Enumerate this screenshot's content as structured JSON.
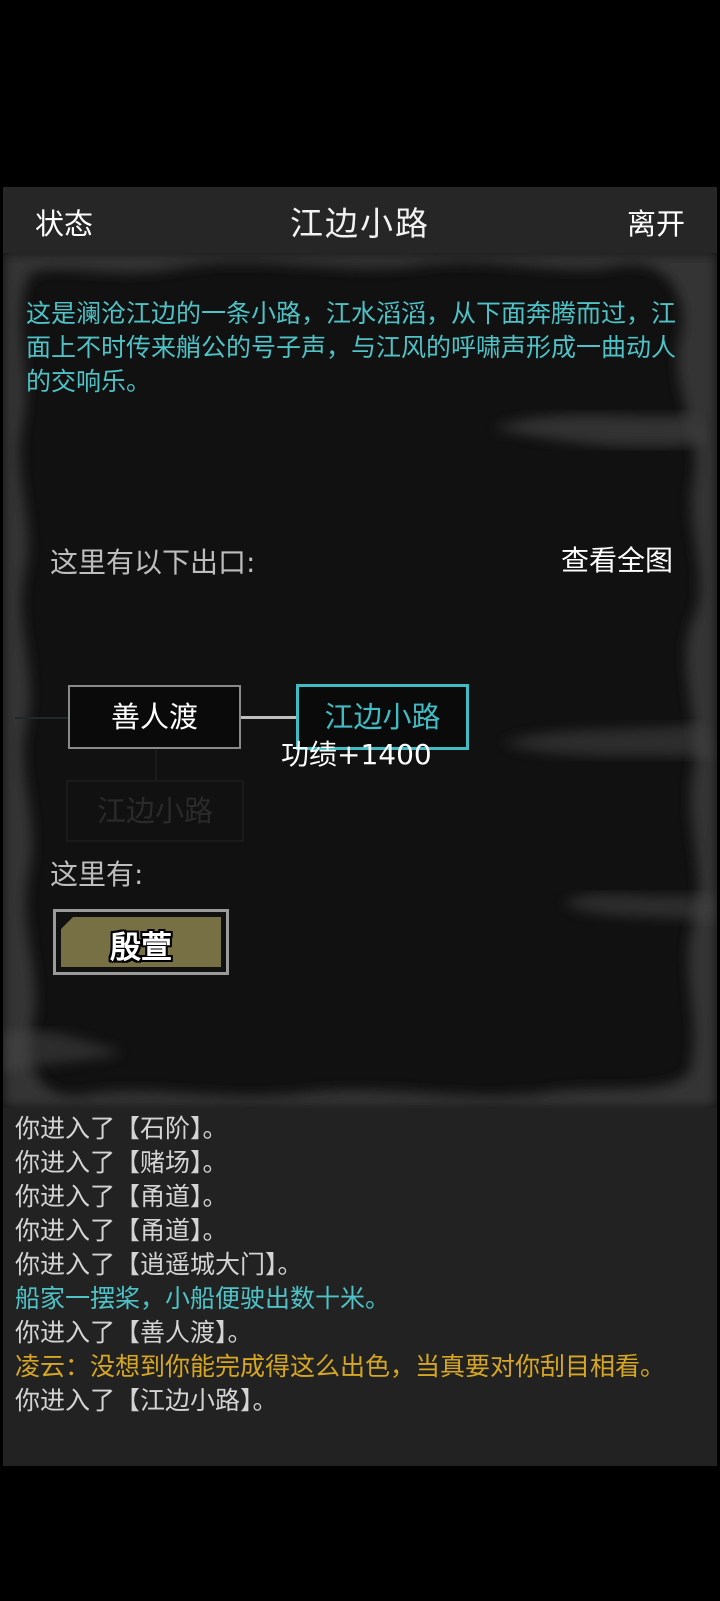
{
  "header": {
    "left_label": "状态",
    "title": "江边小路",
    "right_label": "离开"
  },
  "room": {
    "description": "这是澜沧江边的一条小路，江水滔滔，从下面奔腾而过，江面上不时传来艄公的号子声，与江风的呼啸声形成一曲动人的交响乐。",
    "exits_label": "这里有以下出口:",
    "map_link": "查看全图",
    "exits": {
      "west": "善人渡",
      "current": "江边小路",
      "south_faded": "江边小路"
    },
    "merit_popup": "功绩+1400",
    "here_label": "这里有:",
    "npc": "殷萱"
  },
  "colors": {
    "cyan": "#40bcc4",
    "gold": "#d7a723",
    "npc_button": "#777044",
    "header_bg": "#262626",
    "log_bg": "#222222"
  },
  "log": [
    {
      "text": "你进入了【石阶】。",
      "type": "normal"
    },
    {
      "text": "你进入了【赌场】。",
      "type": "normal"
    },
    {
      "text": "你进入了【甬道】。",
      "type": "normal"
    },
    {
      "text": "你进入了【甬道】。",
      "type": "normal"
    },
    {
      "text": "你进入了【逍遥城大门】。",
      "type": "normal"
    },
    {
      "text": "船家一摆桨，小船便驶出数十米。",
      "type": "cyan"
    },
    {
      "text": "你进入了【善人渡】。",
      "type": "normal"
    },
    {
      "text": "凌云：没想到你能完成得这么出色，当真要对你刮目相看。",
      "type": "gold"
    },
    {
      "text": "你进入了【江边小路】。",
      "type": "normal"
    }
  ]
}
